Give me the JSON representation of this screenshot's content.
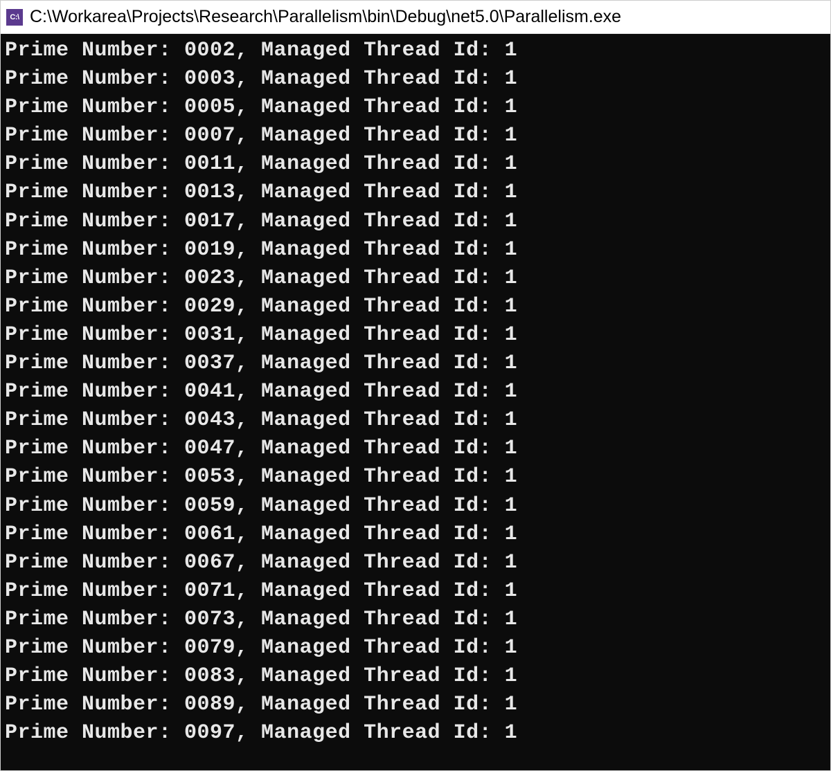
{
  "window": {
    "icon_text": "C:\\",
    "title": "C:\\Workarea\\Projects\\Research\\Parallelism\\bin\\Debug\\net5.0\\Parallelism.exe"
  },
  "console": {
    "line_prefix": "Prime Number: ",
    "line_mid": ", Managed Thread Id: ",
    "lines": [
      {
        "prime": "0002",
        "thread": "1"
      },
      {
        "prime": "0003",
        "thread": "1"
      },
      {
        "prime": "0005",
        "thread": "1"
      },
      {
        "prime": "0007",
        "thread": "1"
      },
      {
        "prime": "0011",
        "thread": "1"
      },
      {
        "prime": "0013",
        "thread": "1"
      },
      {
        "prime": "0017",
        "thread": "1"
      },
      {
        "prime": "0019",
        "thread": "1"
      },
      {
        "prime": "0023",
        "thread": "1"
      },
      {
        "prime": "0029",
        "thread": "1"
      },
      {
        "prime": "0031",
        "thread": "1"
      },
      {
        "prime": "0037",
        "thread": "1"
      },
      {
        "prime": "0041",
        "thread": "1"
      },
      {
        "prime": "0043",
        "thread": "1"
      },
      {
        "prime": "0047",
        "thread": "1"
      },
      {
        "prime": "0053",
        "thread": "1"
      },
      {
        "prime": "0059",
        "thread": "1"
      },
      {
        "prime": "0061",
        "thread": "1"
      },
      {
        "prime": "0067",
        "thread": "1"
      },
      {
        "prime": "0071",
        "thread": "1"
      },
      {
        "prime": "0073",
        "thread": "1"
      },
      {
        "prime": "0079",
        "thread": "1"
      },
      {
        "prime": "0083",
        "thread": "1"
      },
      {
        "prime": "0089",
        "thread": "1"
      },
      {
        "prime": "0097",
        "thread": "1"
      }
    ]
  }
}
